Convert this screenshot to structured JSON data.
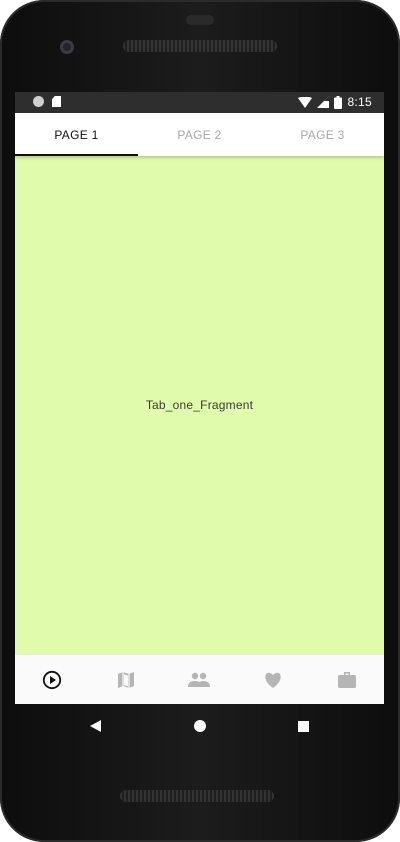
{
  "status_bar": {
    "time": "8:15",
    "left_icons": [
      "notification-dot-icon",
      "sd-card-icon"
    ],
    "right_icons": [
      "wifi-icon",
      "cell-signal-icon",
      "battery-icon"
    ]
  },
  "tabs": [
    {
      "label": "PAGE 1",
      "active": true
    },
    {
      "label": "PAGE 2",
      "active": false
    },
    {
      "label": "PAGE 3",
      "active": false
    }
  ],
  "content": {
    "fragment_text": "Tab_one_Fragment",
    "background_color": "#e0fbab"
  },
  "bottom_nav": {
    "items": [
      {
        "icon": "play-circle-icon",
        "active": true
      },
      {
        "icon": "map-icon",
        "active": false
      },
      {
        "icon": "people-icon",
        "active": false
      },
      {
        "icon": "heart-icon",
        "active": false
      },
      {
        "icon": "briefcase-icon",
        "active": false
      }
    ]
  },
  "system_nav": [
    "back-icon",
    "home-icon",
    "recents-icon"
  ],
  "colors": {
    "active": "#111111",
    "inactive": "#a7a7a7",
    "bottom_nav_inactive": "#b5b5b5"
  }
}
